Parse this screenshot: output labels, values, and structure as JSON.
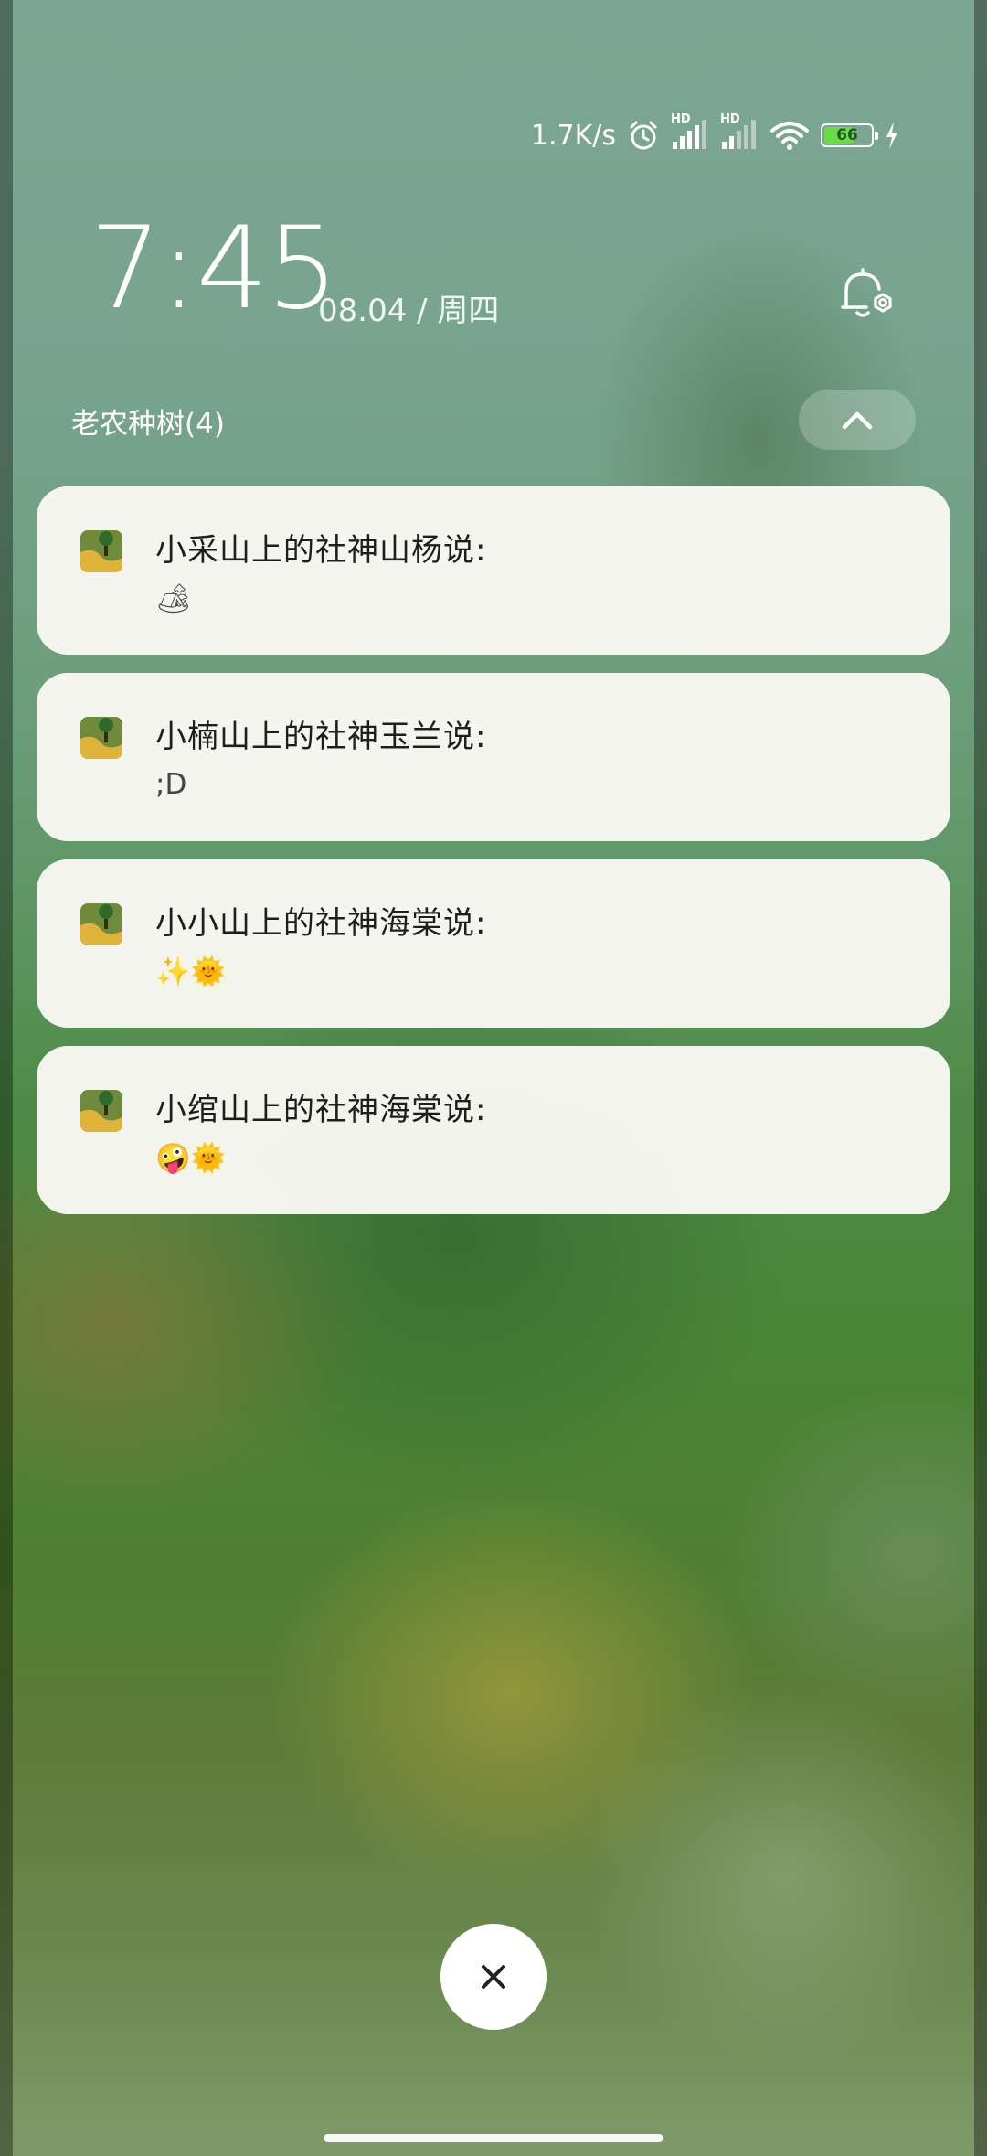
{
  "status_bar": {
    "network_speed": "1.7K/s",
    "alarm_icon": "alarm-clock-icon",
    "sim1": "HD",
    "sim2": "HD",
    "wifi_icon": "wifi-icon",
    "battery_percent": "66",
    "battery_level": 0.66,
    "charging_icon": "lightning-icon"
  },
  "lockscreen": {
    "time": "7:45",
    "date": "08.04 / 周四"
  },
  "notification_group": {
    "title": "老农种树(4)",
    "collapse_icon": "chevron-up-icon",
    "items": [
      {
        "title": "小采山上的社神山杨说:",
        "body": "🏕"
      },
      {
        "title": "小楠山上的社神玉兰说:",
        "body": ";D"
      },
      {
        "title": "小小山上的社神海棠说:",
        "body": "✨🌞"
      },
      {
        "title": "小绾山上的社神海棠说:",
        "body": "🤪🌞"
      }
    ]
  },
  "clear_button": {
    "icon": "close-icon"
  },
  "colors": {
    "card_background": "#faf9f4",
    "battery_fill": "#6cd948",
    "text_primary": "#1e1e1e"
  }
}
